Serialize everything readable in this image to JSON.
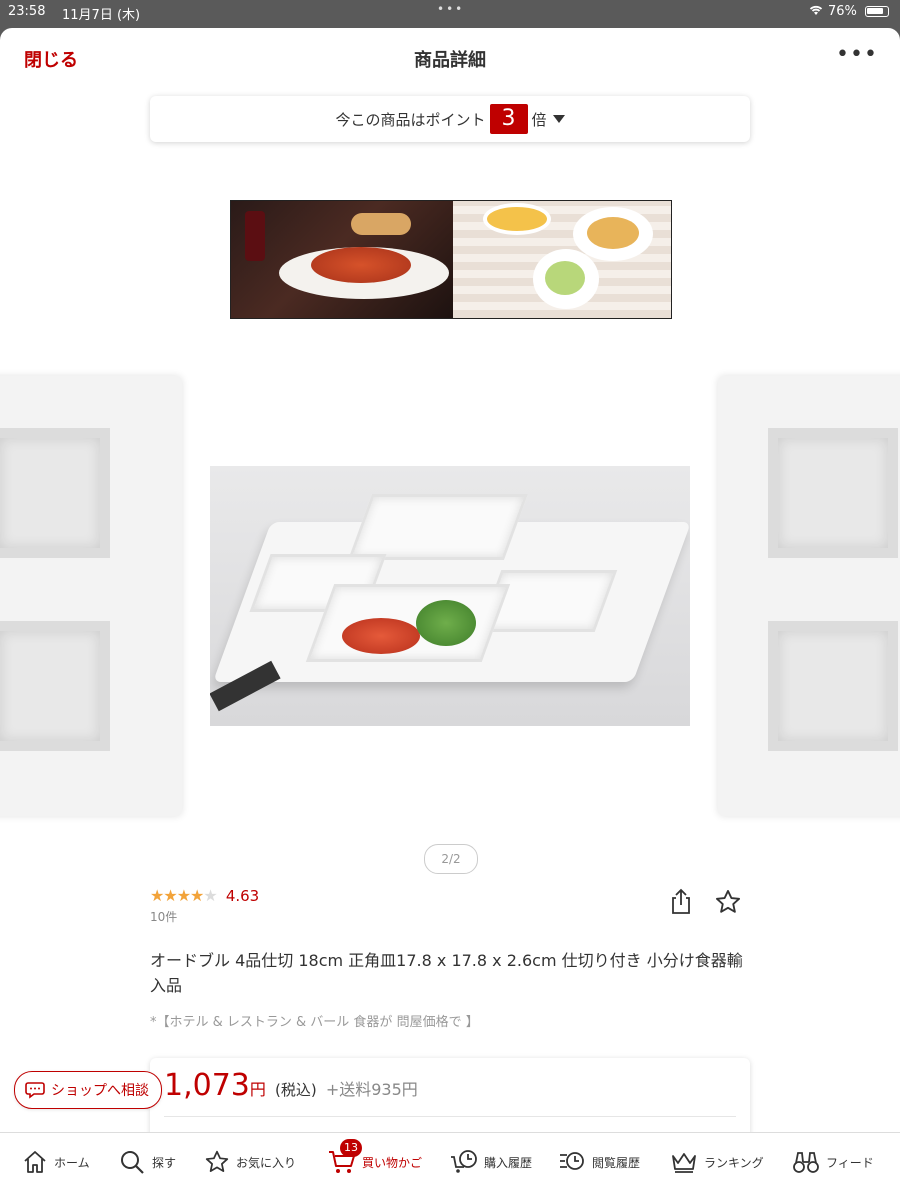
{
  "status_bar": {
    "time": "23:58",
    "date": "11月7日 (木)",
    "battery": "76%"
  },
  "nav": {
    "close_label": "閉じる",
    "title": "商品詳細",
    "more_icon": "ellipsis-icon"
  },
  "points": {
    "prefix": "今この商品はポイント",
    "multiplier": "3",
    "suffix": "倍"
  },
  "carousel": {
    "indicator": "2/2"
  },
  "rating": {
    "stars": 4.63,
    "value": "4.63",
    "count": "10件"
  },
  "product": {
    "title": "オードブル 4品仕切 18cm 正角皿17.8 x 17.8 x 2.6cm 仕切り付き 小分け食器輸入品",
    "tagline": "*【ホテル & レストラン & バール 食器が 問屋価格で 】"
  },
  "price": {
    "amount": "1,073",
    "yen": "円",
    "tax": "(税込)",
    "shipping": "+送料935円"
  },
  "consult": {
    "label": "ショップへ相談"
  },
  "tabs": [
    {
      "label": "ホーム",
      "icon": "home-icon"
    },
    {
      "label": "探す",
      "icon": "search-icon"
    },
    {
      "label": "お気に入り",
      "icon": "star-icon"
    },
    {
      "label": "買い物かご",
      "icon": "cart-icon",
      "badge": "13"
    },
    {
      "label": "購入履歴",
      "icon": "purchase-history-icon"
    },
    {
      "label": "閲覧履歴",
      "icon": "browse-history-icon"
    },
    {
      "label": "ランキング",
      "icon": "crown-icon"
    },
    {
      "label": "フィード",
      "icon": "binoculars-icon"
    }
  ],
  "colors": {
    "accent": "#bf0000",
    "star": "#f2a33a"
  }
}
